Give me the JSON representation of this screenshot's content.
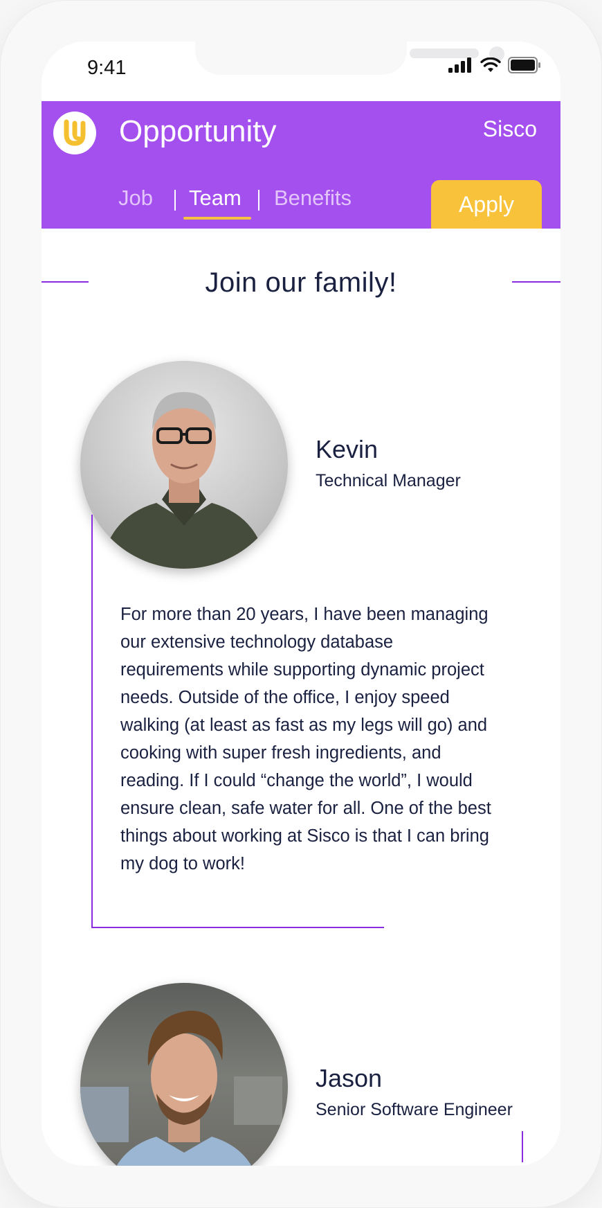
{
  "status_bar": {
    "time": "9:41"
  },
  "header": {
    "app_title": "Opportunity",
    "company": "Sisco",
    "logo_icon": "u-logo-icon",
    "brand_color": "#a450ef",
    "accent_color": "#f9c23b"
  },
  "tabs": [
    {
      "label": "Job",
      "active": false
    },
    {
      "label": "Team",
      "active": true
    },
    {
      "label": "Benefits",
      "active": false
    }
  ],
  "apply_label": "Apply",
  "section": {
    "title": "Join our family!"
  },
  "members": [
    {
      "name": "Kevin",
      "role": "Technical Manager",
      "bio": "For more than 20 years, I have been managing our extensive technology database requirements while supporting dynamic project needs. Outside of the office, I enjoy speed walking (at least as fast as my legs will go) and cooking with super fresh ingredients, and reading. If I could “change the world”, I would ensure clean, safe water for all. One of the best things about working at Sisco is that I can bring my dog to work!"
    },
    {
      "name": "Jason",
      "role": "Senior Software Engineer"
    }
  ]
}
